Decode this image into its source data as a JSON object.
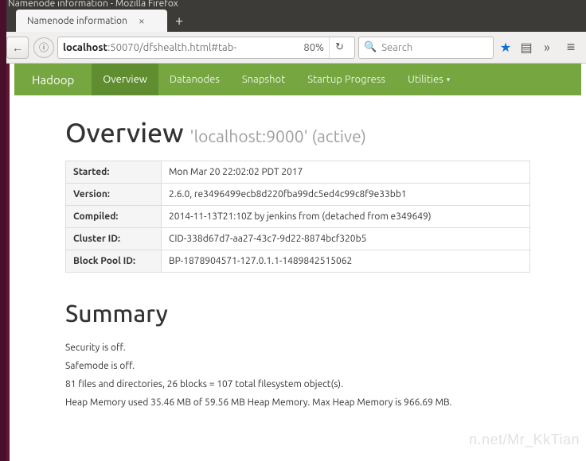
{
  "window": {
    "title": "Namenode information - Mozilla Firefox"
  },
  "browser": {
    "tab_title": "Namenode information",
    "url_host": "localhost",
    "url_rest": ":50070/dfshealth.html#tab-",
    "zoom": "80%",
    "search_placeholder": "Search"
  },
  "navbar": {
    "brand": "Hadoop",
    "items": [
      {
        "label": "Overview",
        "active": true
      },
      {
        "label": "Datanodes",
        "active": false
      },
      {
        "label": "Snapshot",
        "active": false
      },
      {
        "label": "Startup Progress",
        "active": false
      },
      {
        "label": "Utilities",
        "active": false,
        "dropdown": true
      }
    ]
  },
  "overview": {
    "heading": "Overview",
    "sub": "'localhost:9000' (active)",
    "rows": [
      {
        "label": "Started:",
        "value": "Mon Mar 20 22:02:02 PDT 2017"
      },
      {
        "label": "Version:",
        "value": "2.6.0, re3496499ecb8d220fba99dc5ed4c99c8f9e33bb1"
      },
      {
        "label": "Compiled:",
        "value": "2014-11-13T21:10Z by jenkins from (detached from e349649)"
      },
      {
        "label": "Cluster ID:",
        "value": "CID-338d67d7-aa27-43c7-9d22-8874bcf320b5"
      },
      {
        "label": "Block Pool ID:",
        "value": "BP-1878904571-127.0.1.1-1489842515062"
      }
    ]
  },
  "summary": {
    "heading": "Summary",
    "lines": [
      "Security is off.",
      "Safemode is off.",
      "81 files and directories, 26 blocks = 107 total filesystem object(s).",
      "Heap Memory used 35.46 MB of 59.56 MB Heap Memory. Max Heap Memory is 966.69 MB."
    ]
  },
  "watermark": "n.net/Mr_KkTian"
}
